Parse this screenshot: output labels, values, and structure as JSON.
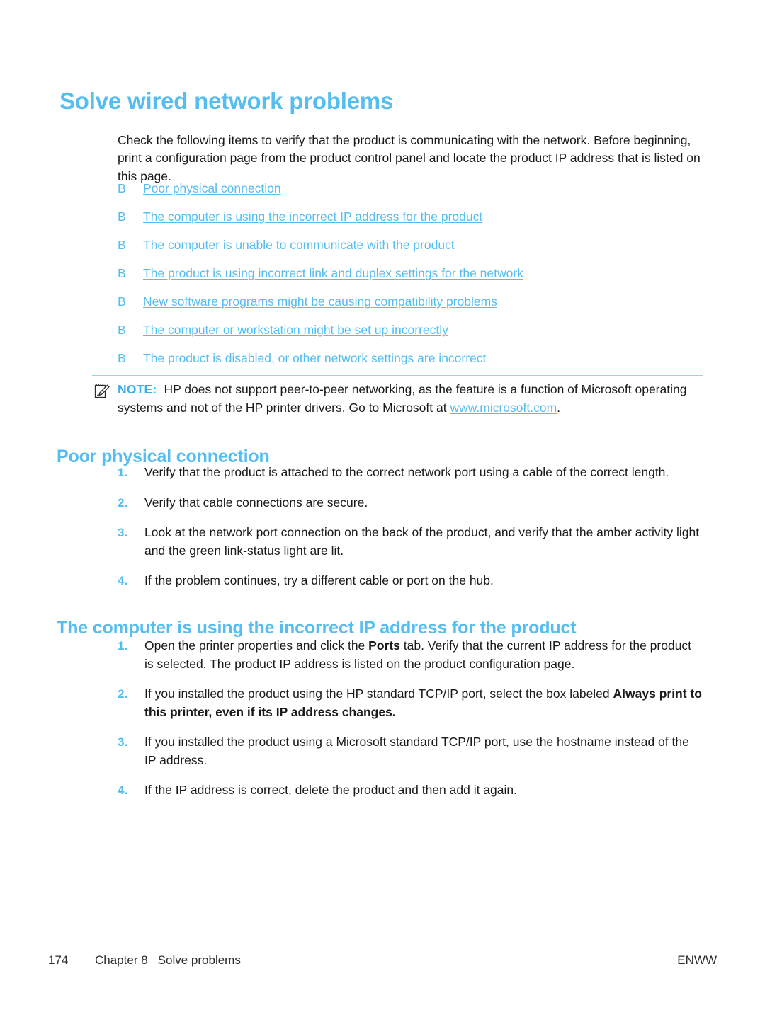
{
  "page": {
    "title": "Solve wired network problems",
    "accent_color": "#55bdf0",
    "text_color": "#1a1a1a",
    "intro": "Check the following items to verify that the product is communicating with the network. Before beginning, print a configuration page from the product control panel and locate the product IP address that is listed on this page."
  },
  "link_list": {
    "bullet_glyph": "B",
    "items": [
      {
        "label": "Poor physical connection"
      },
      {
        "label": "The computer is using the incorrect IP address for the product"
      },
      {
        "label": "The computer is unable to communicate with the product"
      },
      {
        "label": "The product is using incorrect link and duplex settings for the network"
      },
      {
        "label": "New software programs might be causing compatibility problems"
      },
      {
        "label": "The computer or workstation might be set up incorrectly"
      },
      {
        "label": "The product is disabled, or other network settings are incorrect"
      }
    ]
  },
  "note": {
    "icon": "note-pencil-icon",
    "label": "NOTE:",
    "text_before_link": "HP does not support peer-to-peer networking, as the feature is a function of Microsoft operating systems and not of the HP printer drivers. Go to Microsoft at ",
    "link": "www.microsoft.com",
    "text_after_link": ".",
    "rule_color": "#8fd3f5"
  },
  "section_poor": {
    "heading": "Poor physical connection",
    "steps": [
      {
        "num": "1.",
        "text": "Verify that the product is attached to the correct network port using a cable of the correct length."
      },
      {
        "num": "2.",
        "text": "Verify that cable connections are secure."
      },
      {
        "num": "3.",
        "text": "Look at the network port connection on the back of the product, and verify that the amber activity light and the green link-status light are lit."
      },
      {
        "num": "4.",
        "text": "If the problem continues, try a different cable or port on the hub."
      }
    ]
  },
  "section_ip": {
    "heading": "The computer is using the incorrect IP address for the product",
    "steps": [
      {
        "num": "1.",
        "part1": "Open the printer properties and click the ",
        "bold1": "Ports",
        "part2": " tab. Verify that the current IP address for the product is selected. The product IP address is listed on the product configuration page.",
        "bold2": "",
        "part3": ""
      },
      {
        "num": "2.",
        "part1": "If you installed the product using the HP standard TCP/IP port, select the box labeled ",
        "bold1": "Always print to this printer, even if its IP address changes.",
        "part2": "",
        "bold2": "",
        "part3": ""
      },
      {
        "num": "3.",
        "part1": "If you installed the product using a Microsoft standard TCP/IP port, use the hostname instead of the IP address.",
        "bold1": "",
        "part2": "",
        "bold2": "",
        "part3": ""
      },
      {
        "num": "4.",
        "part1": "If the IP address is correct, delete the product and then add it again.",
        "bold1": "",
        "part2": "",
        "bold2": "",
        "part3": ""
      }
    ]
  },
  "footer": {
    "page_number": "174",
    "chapter": "Chapter 8",
    "chapter_title": "Solve problems",
    "right": "ENWW"
  }
}
